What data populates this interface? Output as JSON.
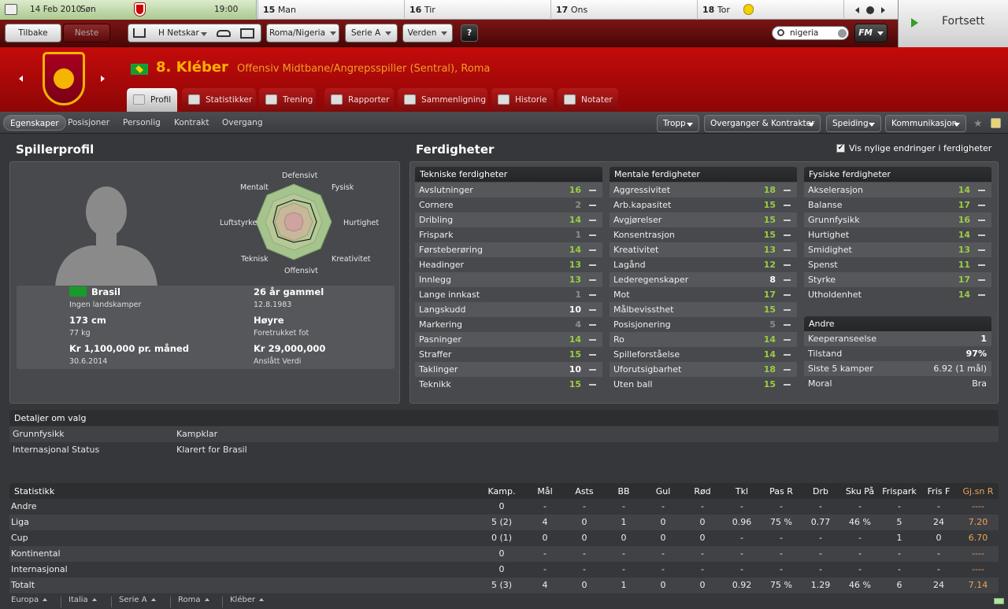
{
  "calendar": {
    "current_date": "14 Feb 2010",
    "current_day": "Søn",
    "time": "19:00",
    "days": [
      {
        "num": "15",
        "name": "Man"
      },
      {
        "num": "16",
        "name": "Tir"
      },
      {
        "num": "17",
        "name": "Ons"
      },
      {
        "num": "18",
        "name": "Tor"
      }
    ]
  },
  "nav": {
    "back": "Tilbake",
    "next": "Neste",
    "team": "H Netskar",
    "match": "Roma/Nigeria",
    "league": "Serie A",
    "world": "Verden",
    "help": "?",
    "search_value": "nigeria",
    "fm": "FM",
    "continue": "Fortsett"
  },
  "player": {
    "number_name": "8. Kléber",
    "position": "Offensiv Midtbane/Angrepsspiller (Sentral), Roma"
  },
  "tabs": [
    "Profil",
    "Statistikker",
    "Trening",
    "Rapporter",
    "Sammenligning",
    "Historie",
    "Notater"
  ],
  "subnav": [
    "Egenskaper",
    "Posisjoner",
    "Personlig",
    "Kontrakt",
    "Overgang"
  ],
  "subnav_right": [
    "Tropp",
    "Overganger & Kontrakter",
    "Speiding",
    "Kommunikasjon"
  ],
  "profile": {
    "title": "Spillerprofil",
    "radar_labels": [
      "Defensivt",
      "Fysisk",
      "Hurtighet",
      "Kreativitet",
      "Offensivt",
      "Teknisk",
      "Luftstyrke",
      "Mentalt"
    ],
    "nation": "Brasil",
    "caps": "Ingen landskamper",
    "age": "26 år gammel",
    "dob": "12.8.1983",
    "height": "173 cm",
    "weight": "77 kg",
    "foot": "Høyre",
    "foot_label": "Foretrukket fot",
    "wage": "Kr 1,100,000 pr. måned",
    "contract_end": "30.6.2014",
    "value": "Kr 29,000,000",
    "value_label": "Anslått Verdi"
  },
  "skills": {
    "title": "Ferdigheter",
    "recent_changes": "Vis nylige endringer i ferdigheter",
    "technical_title": "Tekniske ferdigheter",
    "technical": [
      [
        "Avslutninger",
        "16",
        "g"
      ],
      [
        "Cornere",
        "2",
        "gr"
      ],
      [
        "Dribling",
        "14",
        "g"
      ],
      [
        "Frispark",
        "1",
        "gr"
      ],
      [
        "Førsteberøring",
        "14",
        "g"
      ],
      [
        "Headinger",
        "13",
        "g"
      ],
      [
        "Innlegg",
        "13",
        "g"
      ],
      [
        "Lange innkast",
        "1",
        "gr"
      ],
      [
        "Langskudd",
        "10",
        "w"
      ],
      [
        "Markering",
        "4",
        "gr"
      ],
      [
        "Pasninger",
        "14",
        "g"
      ],
      [
        "Straffer",
        "15",
        "g"
      ],
      [
        "Taklinger",
        "10",
        "w"
      ],
      [
        "Teknikk",
        "15",
        "g"
      ]
    ],
    "mental_title": "Mentale ferdigheter",
    "mental": [
      [
        "Aggressivitet",
        "18",
        "g"
      ],
      [
        "Arb.kapasitet",
        "15",
        "g"
      ],
      [
        "Avgjørelser",
        "15",
        "g"
      ],
      [
        "Konsentrasjon",
        "15",
        "g"
      ],
      [
        "Kreativitet",
        "13",
        "g"
      ],
      [
        "Lagånd",
        "12",
        "g"
      ],
      [
        "Lederegenskaper",
        "8",
        "w"
      ],
      [
        "Mot",
        "17",
        "g"
      ],
      [
        "Målbevissthet",
        "15",
        "g"
      ],
      [
        "Posisjonering",
        "5",
        "gr"
      ],
      [
        "Ro",
        "14",
        "g"
      ],
      [
        "Spilleforståelse",
        "14",
        "g"
      ],
      [
        "Uforutsigbarhet",
        "18",
        "g"
      ],
      [
        "Uten ball",
        "15",
        "g"
      ]
    ],
    "physical_title": "Fysiske ferdigheter",
    "physical": [
      [
        "Akselerasjon",
        "14",
        "g"
      ],
      [
        "Balanse",
        "17",
        "g"
      ],
      [
        "Grunnfysikk",
        "16",
        "g"
      ],
      [
        "Hurtighet",
        "14",
        "g"
      ],
      [
        "Smidighet",
        "13",
        "g"
      ],
      [
        "Spenst",
        "11",
        "g"
      ],
      [
        "Styrke",
        "17",
        "g"
      ],
      [
        "Utholdenhet",
        "14",
        "g"
      ]
    ],
    "other_title": "Andre",
    "other": [
      [
        "Keeperanseelse",
        "1"
      ],
      [
        "Tilstand",
        "97%"
      ],
      [
        "Siste 5 kamper",
        "6.92 (1 mål)"
      ],
      [
        "Moral",
        "Bra"
      ]
    ]
  },
  "details": {
    "title": "Detaljer om valg",
    "rows": [
      [
        "Grunnfysikk",
        "Kampklar"
      ],
      [
        "Internasjonal Status",
        "Klarert for Brasil"
      ]
    ]
  },
  "stats": {
    "title": "Statistikk",
    "columns": [
      "Kamp.",
      "Mål",
      "Asts",
      "BB",
      "Gul",
      "Rød",
      "Tkl",
      "Pas R",
      "Drb",
      "Sku På",
      "Frispark",
      "Fris F",
      "Gj.sn R"
    ],
    "rows": [
      [
        "Andre",
        "0",
        "-",
        "-",
        "-",
        "-",
        "-",
        "-",
        "-",
        "-",
        "-",
        "-",
        "-",
        "----"
      ],
      [
        "Liga",
        "5 (2)",
        "4",
        "0",
        "1",
        "0",
        "0",
        "0.96",
        "75 %",
        "0.77",
        "46 %",
        "5",
        "24",
        "7.20"
      ],
      [
        "Cup",
        "0 (1)",
        "0",
        "0",
        "0",
        "0",
        "0",
        "-",
        "-",
        "-",
        "-",
        "1",
        "0",
        "6.70"
      ],
      [
        "Kontinental",
        "0",
        "-",
        "-",
        "-",
        "-",
        "-",
        "-",
        "-",
        "-",
        "-",
        "-",
        "-",
        "----"
      ],
      [
        "Internasjonal",
        "0",
        "-",
        "-",
        "-",
        "-",
        "-",
        "-",
        "-",
        "-",
        "-",
        "-",
        "-",
        "----"
      ],
      [
        "Totalt",
        "5 (3)",
        "4",
        "0",
        "1",
        "0",
        "0",
        "0.92",
        "75 %",
        "1.29",
        "46 %",
        "6",
        "24",
        "7.14"
      ]
    ]
  },
  "breadcrumb": [
    "Europa",
    "Italia",
    "Serie A",
    "Roma",
    "Kléber"
  ],
  "colors": {
    "header_red": "#c40b0b",
    "skill_green": "#9ccc43",
    "rating_orange": "#f0a25a"
  }
}
